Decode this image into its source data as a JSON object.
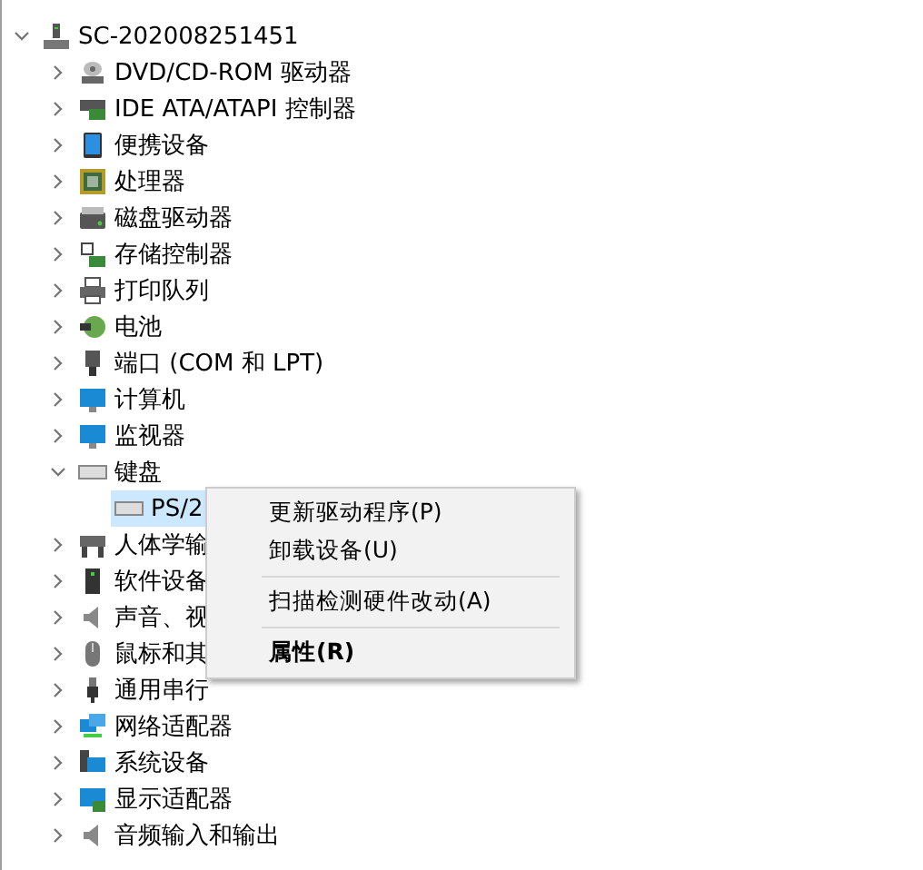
{
  "tree": {
    "label": "SC-202008251451",
    "expanded": true,
    "selected": false,
    "children": [
      {
        "label": "DVD/CD-ROM 驱动器",
        "expanded": false,
        "selected": false
      },
      {
        "label": "IDE ATA/ATAPI 控制器",
        "expanded": false,
        "selected": false
      },
      {
        "label": "便携设备",
        "expanded": false,
        "selected": false
      },
      {
        "label": "处理器",
        "expanded": false,
        "selected": false
      },
      {
        "label": "磁盘驱动器",
        "expanded": false,
        "selected": false
      },
      {
        "label": "存储控制器",
        "expanded": false,
        "selected": false
      },
      {
        "label": "打印队列",
        "expanded": false,
        "selected": false
      },
      {
        "label": "电池",
        "expanded": false,
        "selected": false
      },
      {
        "label": "端口 (COM 和 LPT)",
        "expanded": false,
        "selected": false
      },
      {
        "label": "计算机",
        "expanded": false,
        "selected": false
      },
      {
        "label": "监视器",
        "expanded": false,
        "selected": false
      },
      {
        "label": "键盘",
        "expanded": true,
        "selected": false,
        "children": [
          {
            "label": "PS/2",
            "selected": true
          }
        ]
      },
      {
        "label": "人体学输",
        "expanded": false,
        "selected": false
      },
      {
        "label": "软件设备",
        "expanded": false,
        "selected": false
      },
      {
        "label": "声音、视",
        "expanded": false,
        "selected": false
      },
      {
        "label": "鼠标和其",
        "expanded": false,
        "selected": false
      },
      {
        "label": "通用串行",
        "expanded": false,
        "selected": false
      },
      {
        "label": "网络适配器",
        "expanded": false,
        "selected": false
      },
      {
        "label": "系统设备",
        "expanded": false,
        "selected": false
      },
      {
        "label": "显示适配器",
        "expanded": false,
        "selected": false
      },
      {
        "label": "音频输入和输出",
        "expanded": false,
        "selected": false
      }
    ]
  },
  "context_menu": {
    "groups": [
      [
        {
          "label": "更新驱动程序(P)",
          "default": false
        },
        {
          "label": "卸载设备(U)",
          "default": false
        }
      ],
      [
        {
          "label": "扫描检测硬件改动(A)",
          "default": false
        }
      ],
      [
        {
          "label": "属性(R)",
          "default": true
        }
      ]
    ]
  }
}
